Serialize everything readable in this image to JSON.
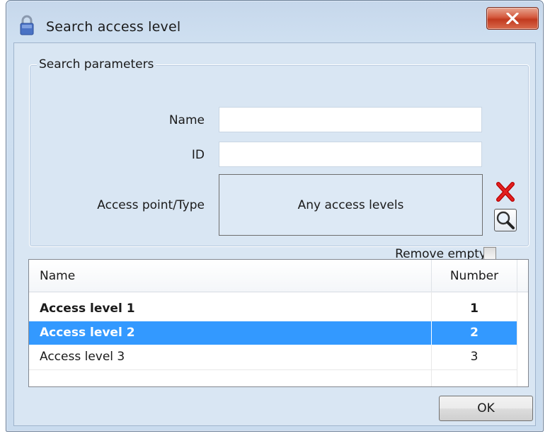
{
  "window": {
    "title": "Search access level",
    "title_icon": "padlock-icon",
    "close_icon": "close-icon"
  },
  "search_parameters": {
    "title": "Search parameters",
    "name_label": "Name",
    "name_value": "",
    "id_label": "ID",
    "id_value": "",
    "access_point_label": "Access point/Type",
    "access_point_value": "Any access levels",
    "clear_icon": "red-x-icon",
    "search_icon": "magnifier-icon",
    "remove_empty_label": "Remove empty",
    "remove_empty_checked": false
  },
  "results": {
    "columns": [
      "Name",
      "Number"
    ],
    "rows": [
      {
        "name": "Access level 1",
        "number": "1",
        "bold": true,
        "selected": false
      },
      {
        "name": "Access level 2",
        "number": "2",
        "bold": true,
        "selected": true
      },
      {
        "name": "Access level 3",
        "number": "3",
        "bold": false,
        "selected": false
      }
    ]
  },
  "buttons": {
    "ok_label": "OK"
  },
  "colors": {
    "selection": "#3399ff",
    "close_button": "#c94a2e",
    "client_background": "#d9e6f3"
  }
}
